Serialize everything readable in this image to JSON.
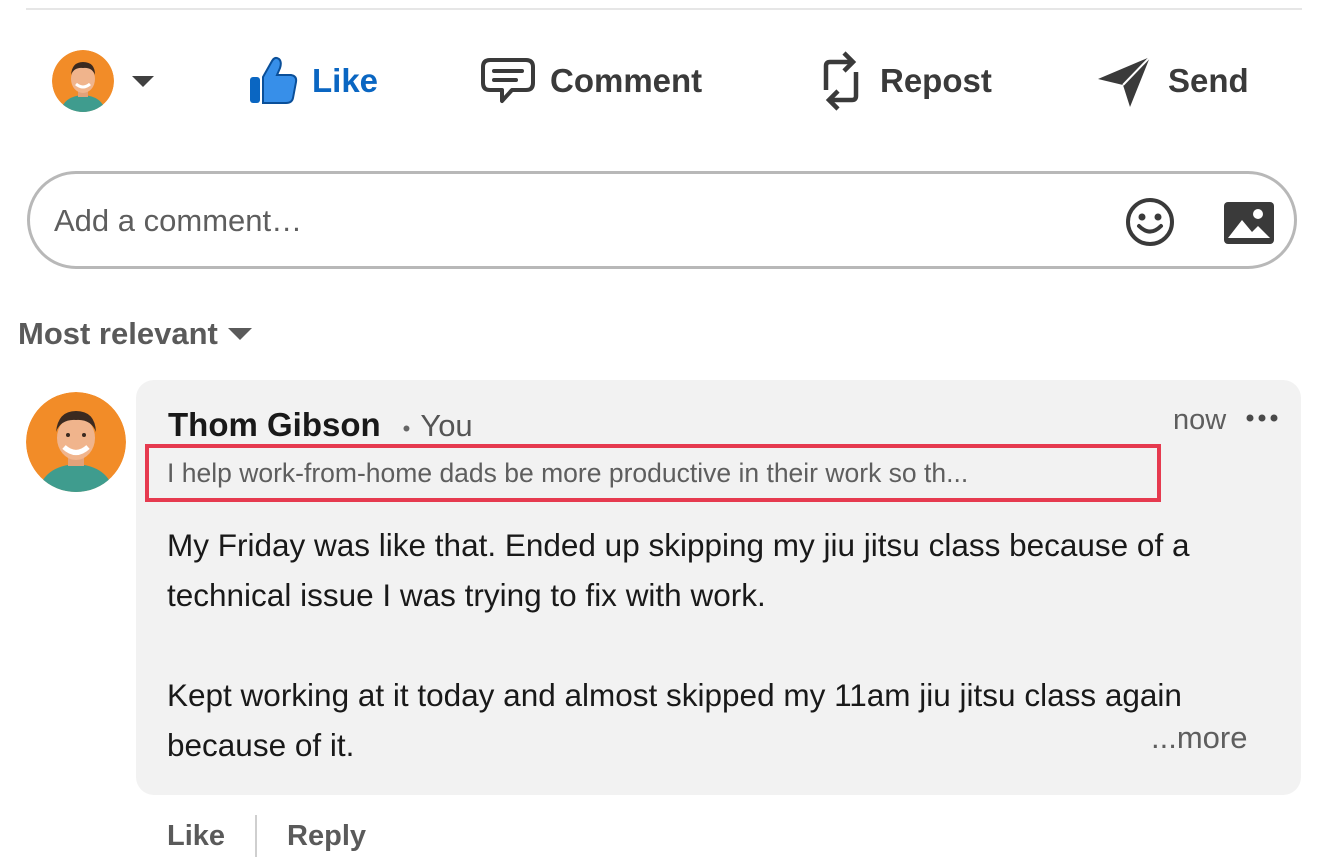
{
  "actions": {
    "like_label": "Like",
    "comment_label": "Comment",
    "repost_label": "Repost",
    "send_label": "Send"
  },
  "comment_input": {
    "placeholder": "Add a comment…"
  },
  "sort": {
    "label": "Most relevant"
  },
  "comment": {
    "author": "Thom Gibson",
    "separator": "•",
    "relation": "You",
    "headline": "I help work-from-home dads be more productive in their work so th...",
    "timestamp": "now",
    "text_line1": "My Friday was like that. Ended up skipping my jiu jitsu class because of a technical issue I was trying to fix with work.",
    "text_line2": "Kept working at it today and almost skipped my 11am jiu jitsu class again because of it.",
    "see_more": "...more",
    "like_label": "Like",
    "reply_label": "Reply"
  },
  "colors": {
    "accent": "#0a66c2",
    "highlight_box": "#e63a4f",
    "bubble_bg": "#f2f2f2",
    "avatar_bg": "#f28c28"
  },
  "icons": {
    "like": "thumbs-up-icon",
    "comment": "speech-bubble-icon",
    "repost": "repost-arrows-icon",
    "send": "paper-plane-icon",
    "emoji": "smiley-icon",
    "image": "image-icon",
    "more": "ellipsis-icon"
  }
}
